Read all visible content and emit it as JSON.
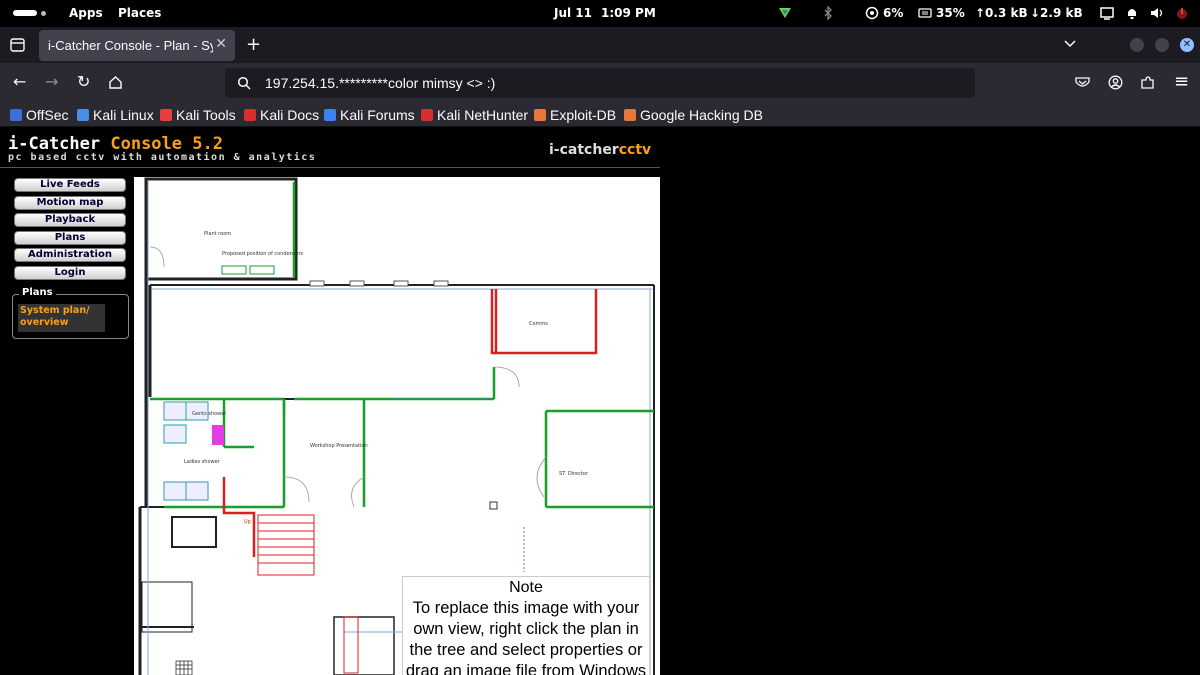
{
  "topbar": {
    "apps": "Apps",
    "places": "Places",
    "date": "Jul 11",
    "time": "1:09 PM",
    "cpu": "6%",
    "mem": "35%",
    "up": "↑0.3 kB",
    "down": "↓2.9 kB"
  },
  "tab": {
    "title": "i-Catcher Console - Plan - Sy"
  },
  "address": {
    "url": "197.254.15.*********color mimsy <> :)"
  },
  "bookmarks": [
    {
      "label": "OffSec",
      "color": "#3a6fd8"
    },
    {
      "label": "Kali Linux",
      "color": "#4a90e2"
    },
    {
      "label": "Kali Tools",
      "color": "#e83e3e"
    },
    {
      "label": "Kali Docs",
      "color": "#d62f2f"
    },
    {
      "label": "Kali Forums",
      "color": "#3b82f6"
    },
    {
      "label": "Kali NetHunter",
      "color": "#d62f2f"
    },
    {
      "label": "Exploit-DB",
      "color": "#e8763a"
    },
    {
      "label": "Google Hacking DB",
      "color": "#e8763a"
    }
  ],
  "header": {
    "brand_main": "i-Catcher ",
    "brand_accent": "Console 5.2",
    "tagline": "pc based cctv with automation & analytics",
    "logo_main": "i-catcher",
    "logo_accent": "cctv"
  },
  "menu": [
    "Live Feeds",
    "Motion map",
    "Playback",
    "Plans",
    "Administration",
    "Login"
  ],
  "plans": {
    "legend": "Plans",
    "item": "System plan/ overview"
  },
  "floorplan": {
    "labels": [
      "Plant room",
      "Proposed position of condensers",
      "Comms",
      "Gents shower",
      "Ladies shower",
      "Workshop Presentation",
      "ST. Director",
      "Up"
    ]
  },
  "note": {
    "heading": "Note",
    "body": "To replace this image with your own view, right click the plan in the tree and select properties or drag an image file from Windows Explorer onto this plan."
  },
  "colors": {
    "accent": "#f7a11a"
  }
}
